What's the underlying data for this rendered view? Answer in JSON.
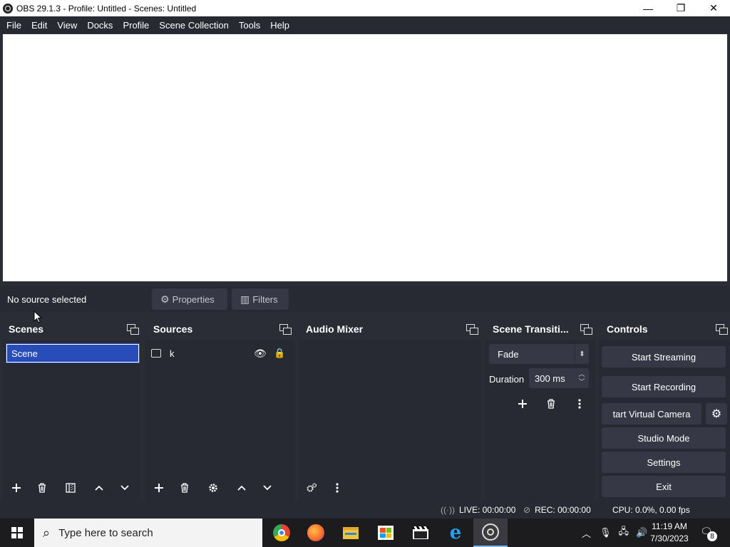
{
  "window": {
    "title": "OBS 29.1.3 - Profile: Untitled - Scenes: Untitled",
    "minimize": "—",
    "maximize": "❐",
    "close": "✕"
  },
  "menu": [
    "File",
    "Edit",
    "View",
    "Docks",
    "Profile",
    "Scene Collection",
    "Tools",
    "Help"
  ],
  "context_bar": {
    "status": "No source selected",
    "properties_label": "Properties",
    "filters_label": "Filters"
  },
  "docks": {
    "scenes": {
      "title": "Scenes",
      "items": [
        "Scene"
      ]
    },
    "sources": {
      "title": "Sources",
      "items": [
        {
          "name": "k",
          "visible": true,
          "locked": false
        }
      ]
    },
    "audio_mixer": {
      "title": "Audio Mixer"
    },
    "transitions": {
      "title": "Scene Transiti...",
      "selected": "Fade",
      "duration_label": "Duration",
      "duration_value": "300 ms"
    },
    "controls": {
      "title": "Controls",
      "start_streaming": "Start Streaming",
      "start_recording": "Start Recording",
      "start_virtual_camera": "tart Virtual Camera",
      "studio_mode": "Studio Mode",
      "settings": "Settings",
      "exit": "Exit"
    }
  },
  "status": {
    "live": "LIVE: 00:00:00",
    "rec": "REC: 00:00:00",
    "cpu": "CPU: 0.0%, 0.00 fps"
  },
  "taskbar": {
    "search_placeholder": "Type here to search",
    "time": "11:19 AM",
    "date": "7/30/2023",
    "notification_count": "8"
  },
  "colors": {
    "dock_bg": "#272a33",
    "button_bg": "#363945",
    "selection": "#284cb8"
  }
}
